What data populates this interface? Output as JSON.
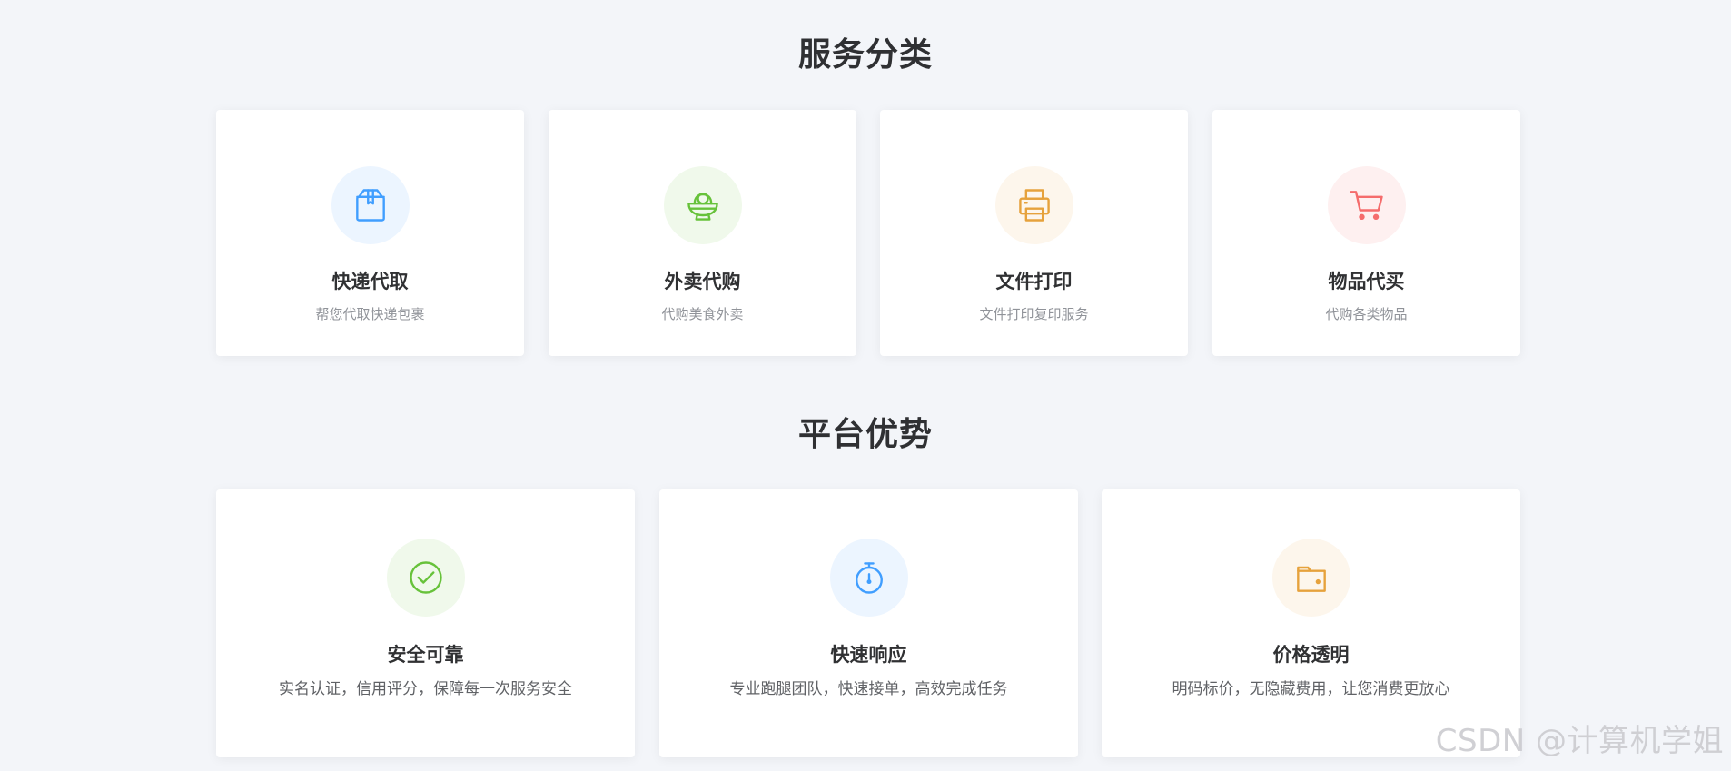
{
  "sections": {
    "services": {
      "title": "服务分类",
      "cards": [
        {
          "title": "快递代取",
          "desc": "帮您代取快递包裹",
          "icon": "package-icon",
          "color": "#409eff",
          "bg": "#ecf5ff"
        },
        {
          "title": "外卖代购",
          "desc": "代购美食外卖",
          "icon": "food-bowl-icon",
          "color": "#67c23a",
          "bg": "#f0f9eb"
        },
        {
          "title": "文件打印",
          "desc": "文件打印复印服务",
          "icon": "printer-icon",
          "color": "#e6a23c",
          "bg": "#fdf6ec"
        },
        {
          "title": "物品代买",
          "desc": "代购各类物品",
          "icon": "shopping-cart-icon",
          "color": "#f56c6c",
          "bg": "#fef0f0"
        }
      ]
    },
    "advantages": {
      "title": "平台优势",
      "cards": [
        {
          "title": "安全可靠",
          "desc": "实名认证，信用评分，保障每一次服务安全",
          "icon": "check-circle-icon",
          "color": "#67c23a",
          "bg": "#f0f9eb"
        },
        {
          "title": "快速响应",
          "desc": "专业跑腿团队，快速接单，高效完成任务",
          "icon": "stopwatch-icon",
          "color": "#409eff",
          "bg": "#ecf5ff"
        },
        {
          "title": "价格透明",
          "desc": "明码标价，无隐藏费用，让您消费更放心",
          "icon": "wallet-icon",
          "color": "#e6a23c",
          "bg": "#fdf6ec"
        }
      ]
    }
  },
  "watermark": "CSDN @计算机学姐"
}
